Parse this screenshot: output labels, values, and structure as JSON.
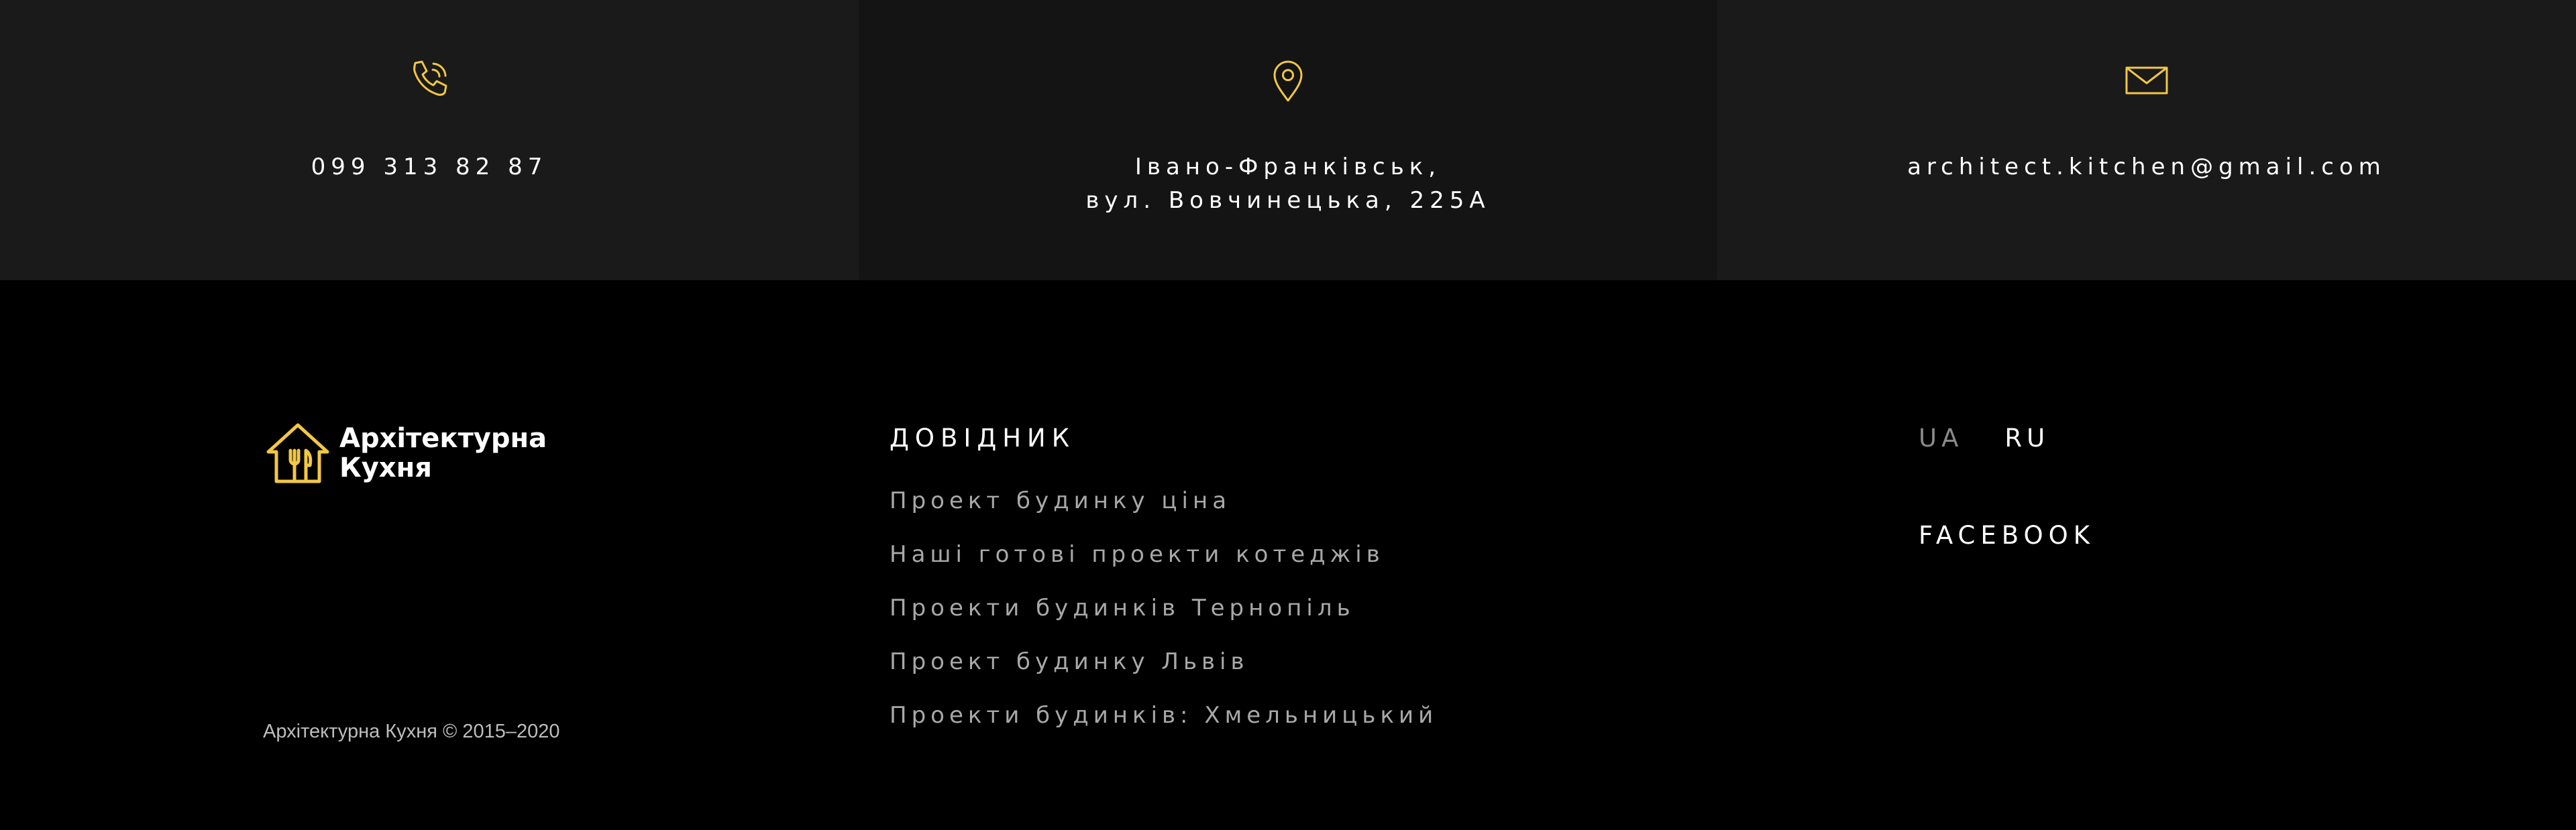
{
  "colors": {
    "accent": "#f2c744",
    "background": "#000000",
    "panel_dark": "#1a1a1a",
    "panel_mid": "#141414"
  },
  "contacts": {
    "phone": {
      "icon": "phone-icon",
      "text": "099 313 82 87"
    },
    "address": {
      "icon": "location-pin-icon",
      "line1": "Івано-Франківськ,",
      "line2": "вул. Вовчинецька, 225А"
    },
    "email": {
      "icon": "envelope-icon",
      "text": "architect.kitchen@gmail.com"
    }
  },
  "footer": {
    "logo": {
      "line1": "Архітектурна",
      "line2": "Кухня"
    },
    "copyright": "Архітектурна Кухня © 2015–2020",
    "guide": {
      "heading": "ДОВІДНИК",
      "links": [
        "Проект будинку ціна",
        "Наші готові проекти котеджів",
        "Проекти будинків Тернопіль",
        "Проект будинку Львів",
        "Проекти будинків: Хмельницький"
      ]
    },
    "lang": {
      "ua": "UA",
      "ru": "RU"
    },
    "social": {
      "facebook": "FACEBOOK"
    }
  }
}
